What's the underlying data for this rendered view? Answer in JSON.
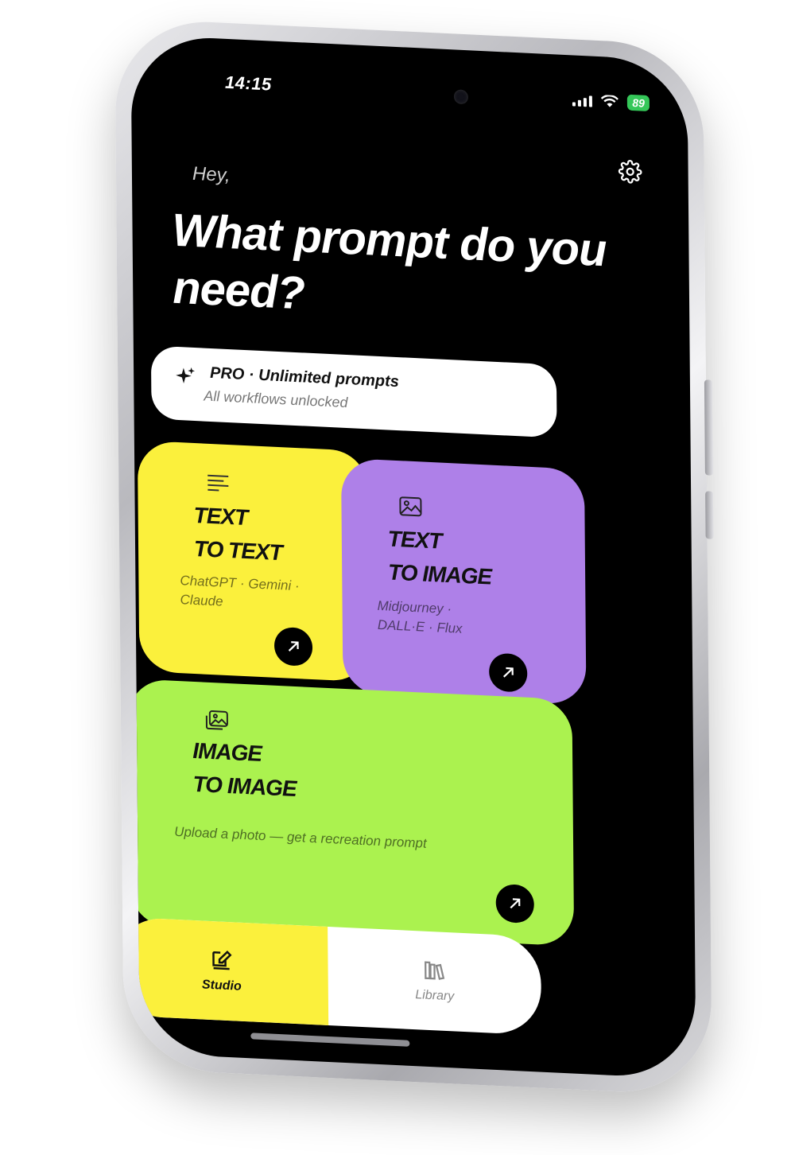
{
  "status_bar": {
    "time": "14:15",
    "battery": "89"
  },
  "header": {
    "greeting": "Hey,",
    "headline": "What prompt do you need?",
    "settings_icon": "gear-icon"
  },
  "pro_banner": {
    "title": "PRO · Unlimited prompts",
    "subtitle": "All workflows unlocked",
    "icon": "sparkle-icon"
  },
  "cards": [
    {
      "title": "TEXT\nTO TEXT",
      "subtitle": "ChatGPT · Gemini · Claude",
      "icon": "lines-icon",
      "color": "#fbf03c"
    },
    {
      "title": "TEXT\nTO IMAGE",
      "subtitle": "Midjourney · DALL·E · Flux",
      "icon": "image-icon",
      "color": "#ae80e8"
    },
    {
      "title": "IMAGE\nTO IMAGE",
      "subtitle": "Upload a photo — get a recreation prompt",
      "icon": "images-icon",
      "color": "#abf24f"
    }
  ],
  "tab_bar": {
    "tabs": [
      {
        "label": "Studio",
        "icon": "edit-icon",
        "active": true
      },
      {
        "label": "Library",
        "icon": "books-icon",
        "active": false
      }
    ],
    "active_color": "#fbf03c"
  }
}
